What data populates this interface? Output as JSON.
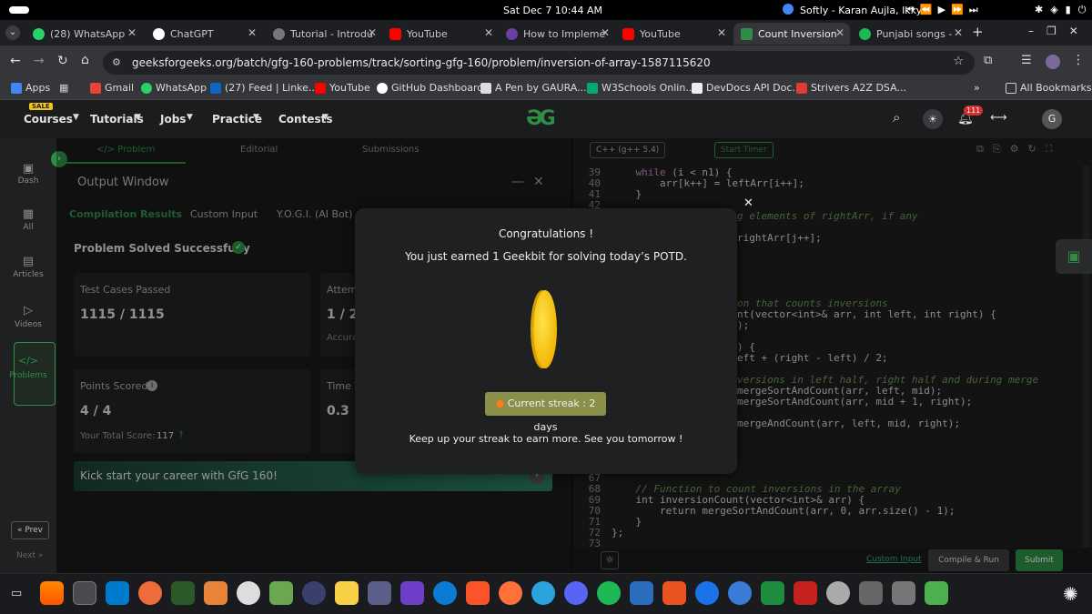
{
  "system_bar": {
    "datetime": "Sat Dec 7  10:44 AM",
    "now_playing": "Softly - Karan Aujla, Ikky"
  },
  "tabs": [
    {
      "label": "(28) WhatsApp",
      "color": "#25d366"
    },
    {
      "label": "ChatGPT",
      "color": "#ffffff"
    },
    {
      "label": "Tutorial - Introdu",
      "color": "#777777"
    },
    {
      "label": "YouTube",
      "color": "#ff0000"
    },
    {
      "label": "How to Impleme",
      "color": "#6b3fa0"
    },
    {
      "label": "YouTube",
      "color": "#ff0000"
    },
    {
      "label": "Count Inversion",
      "color": "#2f8d46"
    },
    {
      "label": "Punjabi songs - ",
      "color": "#1db954"
    }
  ],
  "address": {
    "url": "geeksforgeeks.org/batch/gfg-160-problems/track/sorting-gfg-160/problem/inversion-of-array-1587115620"
  },
  "bookmarks": [
    {
      "label": "Apps",
      "color": "#4285f4"
    },
    {
      "label": "Gmail",
      "color": "#ea4335"
    },
    {
      "label": "WhatsApp",
      "color": "#25d366"
    },
    {
      "label": "(27) Feed | Linke...",
      "color": "#0a66c2"
    },
    {
      "label": "YouTube",
      "color": "#ff0000"
    },
    {
      "label": "GitHub Dashboard",
      "color": "#ffffff"
    },
    {
      "label": "A Pen by GAURA...",
      "color": "#dddddd"
    },
    {
      "label": "W3Schools Onlin...",
      "color": "#04aa6d"
    },
    {
      "label": "DevDocs API Doc...",
      "color": "#eeeeee"
    },
    {
      "label": "Strivers A2Z DSA...",
      "color": "#e53935"
    }
  ],
  "all_bookmarks": "All Bookmarks",
  "gfg_nav": {
    "sale_badge": "SALE",
    "items": [
      "Courses",
      "Tutorials",
      "Jobs",
      "Practice",
      "Contests"
    ],
    "notif_count": "111",
    "avatar": "G"
  },
  "left_rail": {
    "items": [
      "Dash",
      "All",
      "Articles",
      "Videos",
      "Problems"
    ],
    "prev": "« Prev",
    "next": "Next »"
  },
  "problem_tabs": [
    "</> Problem",
    "Editorial",
    "Submissions"
  ],
  "output_window": {
    "title": "Output Window",
    "tabs": [
      "Compilation Results",
      "Custom Input",
      "Y.O.G.I. (AI Bot)"
    ],
    "status": "Problem Solved Successfully",
    "test_cases_label": "Test Cases Passed",
    "test_cases_value": "1115 / 1115",
    "attempts_label": "Attem",
    "attempts_value": "1 / 2",
    "accuracy_label": "Accura",
    "points_label": "Points Scored",
    "points_value": "4 / 4",
    "total_score_label": "Your Total Score:",
    "total_score_value": "117",
    "time_label": "Time T",
    "time_value": "0.3",
    "banner": "Kick start your career with GfG 160!"
  },
  "editor": {
    "language": "C++ (g++ 5.4)",
    "timer": "Start Timer",
    "lines": [
      {
        "n": "39",
        "text": "    while (i < n1) {"
      },
      {
        "n": "40",
        "text": "        arr[k++] = leftArr[i++];"
      },
      {
        "n": "41",
        "text": "    }"
      },
      {
        "n": "42",
        "text": ""
      },
      {
        "n": "67",
        "text": ""
      },
      {
        "n": "68",
        "text": "    // Function to count inversions in the array"
      },
      {
        "n": "69",
        "text": "    int inversionCount(vector<int>& arr) {"
      },
      {
        "n": "70",
        "text": "        return mergeSortAndCount(arr, 0, arr.size() - 1);"
      },
      {
        "n": "71",
        "text": "    }"
      },
      {
        "n": "72",
        "text": "};"
      },
      {
        "n": "73",
        "text": ""
      }
    ],
    "partial": [
      "g elements of rightArr, if any",
      "rightArr[j++];",
      "on that counts inversions",
      "nt(vector<int>& arr, int left, int right) {",
      ");",
      ") {",
      "eft + (right - left) / 2;",
      "versions in left half, right half and during merge",
      "mergeSortAndCount(arr, left, mid);",
      "mergeSortAndCount(arr, mid + 1, right);",
      "mergeAndCount(arr, left, mid, right);"
    ],
    "custom_input": "Custom Input",
    "compile": "Compile & Run",
    "submit": "Submit"
  },
  "modal": {
    "title": "Congratulations !",
    "message": "You just earned 1 Geekbit for solving today’s POTD.",
    "streak": "Current streak : 2 days",
    "footer": "Keep up your streak to earn more. See you tomorrow !"
  },
  "colors": {
    "gfg_green": "#2f8d46",
    "coin": "#f5c518",
    "streak_bg": "#8a8f4a"
  }
}
